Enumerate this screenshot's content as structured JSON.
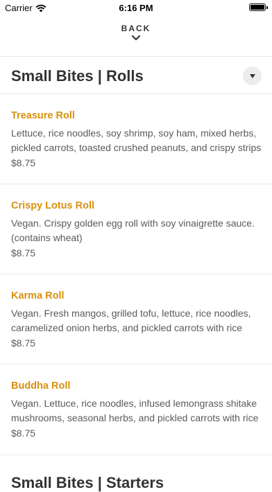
{
  "status_bar": {
    "carrier": "Carrier",
    "time": "6:16 PM"
  },
  "nav": {
    "back_label": "BACK"
  },
  "section": {
    "title": "Small Bites | Rolls"
  },
  "items": [
    {
      "name": "Treasure Roll",
      "description": "Lettuce, rice noodles, soy shrimp, soy ham, mixed herbs, pickled carrots, toasted crushed peanuts, and crispy strips",
      "price": "$8.75"
    },
    {
      "name": "Crispy Lotus Roll",
      "description": "Vegan. Crispy golden egg roll with soy vinaigrette sauce. (contains wheat)",
      "price": "$8.75"
    },
    {
      "name": "Karma Roll",
      "description": "Vegan. Fresh mangos, grilled tofu, lettuce, rice noodles, caramelized onion herbs, and pickled carrots with rice",
      "price": "$8.75"
    },
    {
      "name": "Buddha Roll",
      "description": "Vegan. Lettuce, rice noodles, infused lemongrass shitake mushrooms, seasonal herbs, and pickled carrots with rice",
      "price": "$8.75"
    }
  ],
  "next_section": {
    "title": "Small Bites | Starters"
  },
  "colors": {
    "accent": "#d9900f",
    "divider": "#e8e8e8",
    "text": "#5a5a5a"
  }
}
